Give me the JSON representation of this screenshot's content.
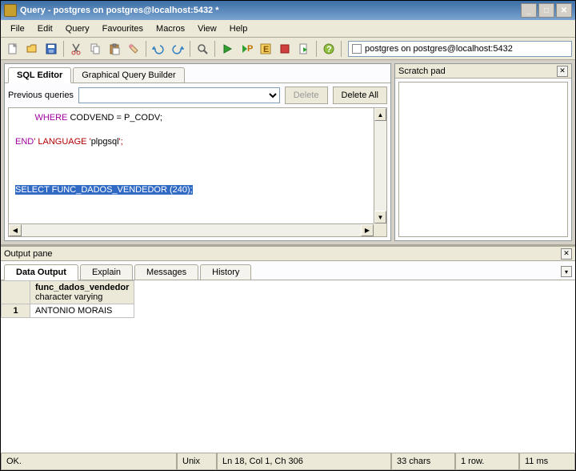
{
  "window": {
    "title": "Query - postgres on postgres@localhost:5432 *"
  },
  "menu": {
    "file": "File",
    "edit": "Edit",
    "query": "Query",
    "favourites": "Favourites",
    "macros": "Macros",
    "view": "View",
    "help": "Help"
  },
  "toolbar": {
    "connection": "postgres on postgres@localhost:5432"
  },
  "editor": {
    "tabs": {
      "sql": "SQL Editor",
      "gqb": "Graphical Query Builder"
    },
    "prev_label": "Previous queries",
    "delete_btn": "Delete",
    "delete_all_btn": "Delete All",
    "code": {
      "line1_where": "WHERE",
      "line1_rest": " CODVEND = P_CODV;",
      "line3_end": "END",
      "line3_lang": "' LANGUAGE '",
      "line3_plpg": "plpgsql",
      "line3_close": "';",
      "line7_sel": "SELECT FUNC_DADOS_VENDEDOR (240);"
    }
  },
  "scratch": {
    "title": "Scratch pad"
  },
  "output": {
    "pane_title": "Output pane",
    "tabs": {
      "data": "Data Output",
      "explain": "Explain",
      "messages": "Messages",
      "history": "History"
    },
    "col_name": "func_dados_vendedor",
    "col_type": "character varying",
    "rows": [
      {
        "n": "1",
        "val": "ANTONIO MORAIS"
      }
    ]
  },
  "status": {
    "msg": "OK.",
    "enc": "Unix",
    "pos": "Ln 18, Col 1, Ch 306",
    "chars": "33 chars",
    "rows": "1 row.",
    "time": "11 ms"
  }
}
